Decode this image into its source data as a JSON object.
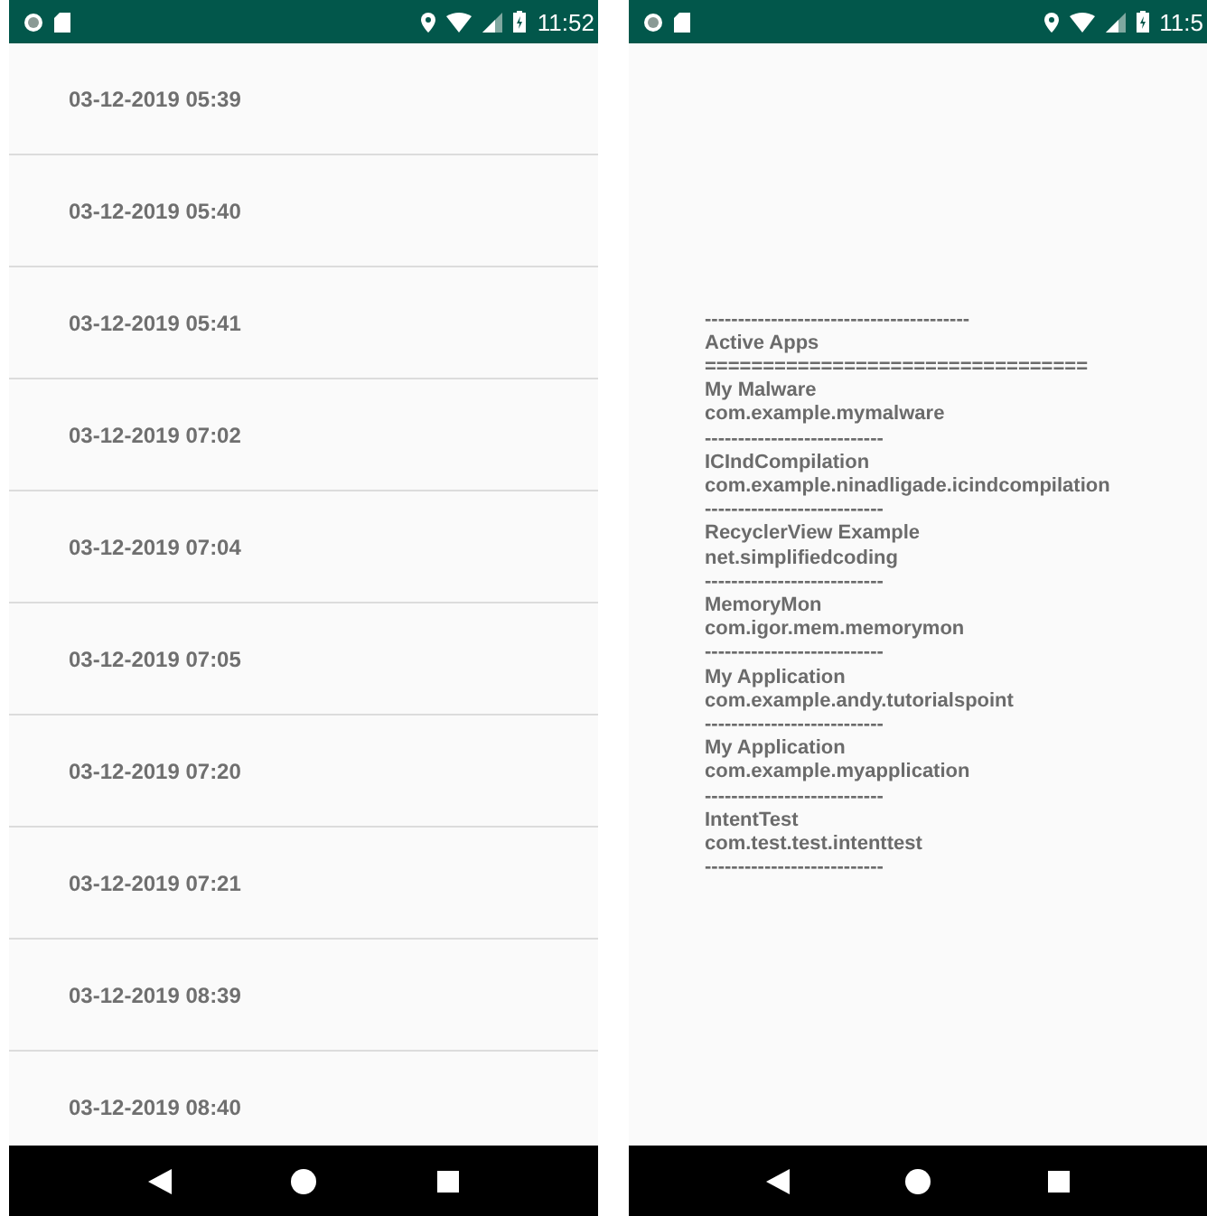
{
  "phones": [
    {
      "kind": "list",
      "status_bar": {
        "time": "11:52"
      },
      "items": [
        "03-12-2019 05:39",
        "03-12-2019 05:40",
        "03-12-2019 05:41",
        "03-12-2019 07:02",
        "03-12-2019 07:04",
        "03-12-2019 07:05",
        "03-12-2019 07:20",
        "03-12-2019 07:21",
        "03-12-2019 08:39",
        "03-12-2019 08:40"
      ]
    },
    {
      "kind": "text",
      "status_bar": {
        "time": "11:5"
      },
      "lines": [
        "----------------------------------------",
        "Active Apps",
        "=================================",
        "My Malware",
        "com.example.mymalware",
        "---------------------------",
        "ICIndCompilation",
        "com.example.ninadligade.icindcompilation",
        "---------------------------",
        "RecyclerView Example",
        "net.simplifiedcoding",
        "---------------------------",
        "MemoryMon",
        "com.igor.mem.memorymon",
        "---------------------------",
        "My Application",
        "com.example.andy.tutorialspoint",
        "---------------------------",
        "My Application",
        "com.example.myapplication",
        "---------------------------",
        "IntentTest",
        "com.test.test.intenttest",
        "---------------------------"
      ]
    }
  ]
}
